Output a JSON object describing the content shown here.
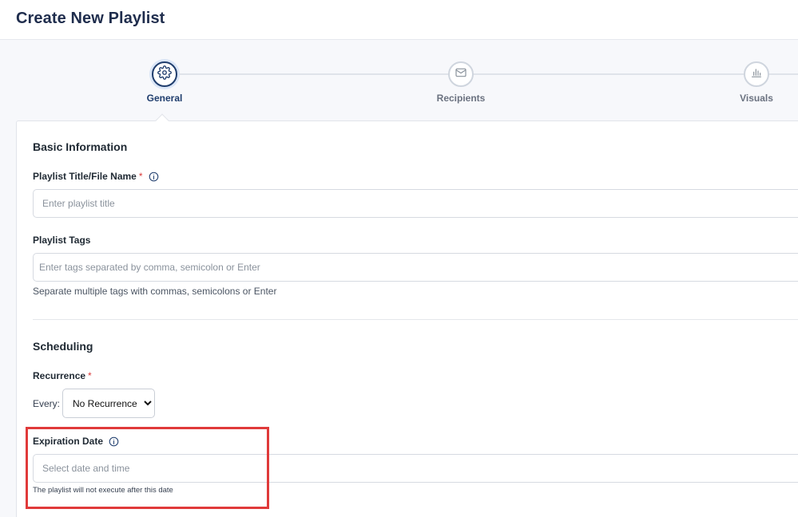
{
  "page": {
    "title": "Create New Playlist"
  },
  "stepper": {
    "steps": [
      {
        "label": "General",
        "icon": "gear-icon",
        "active": true
      },
      {
        "label": "Recipients",
        "icon": "envelope-icon",
        "active": false
      },
      {
        "label": "Visuals",
        "icon": "bar-chart-icon",
        "active": false
      }
    ]
  },
  "basic_info": {
    "title": "Basic Information",
    "playlist_title": {
      "label": "Playlist Title/File Name",
      "required_mark": "*",
      "placeholder": "Enter playlist title",
      "value": ""
    },
    "playlist_tags": {
      "label": "Playlist Tags",
      "placeholder": "Enter tags separated by comma, semicolon or Enter",
      "help": "Separate multiple tags with commas, semicolons or Enter",
      "value": ""
    }
  },
  "scheduling": {
    "title": "Scheduling",
    "recurrence": {
      "label": "Recurrence",
      "required_mark": "*",
      "every_label": "Every:",
      "selected": "No Recurrence"
    },
    "expiration": {
      "label": "Expiration Date",
      "placeholder": "Select date and time",
      "help": "The playlist will not execute after this date",
      "value": ""
    }
  },
  "colors": {
    "accent": "#1f3d6d",
    "highlight": "#e03a3a",
    "required": "#d93a3a"
  }
}
